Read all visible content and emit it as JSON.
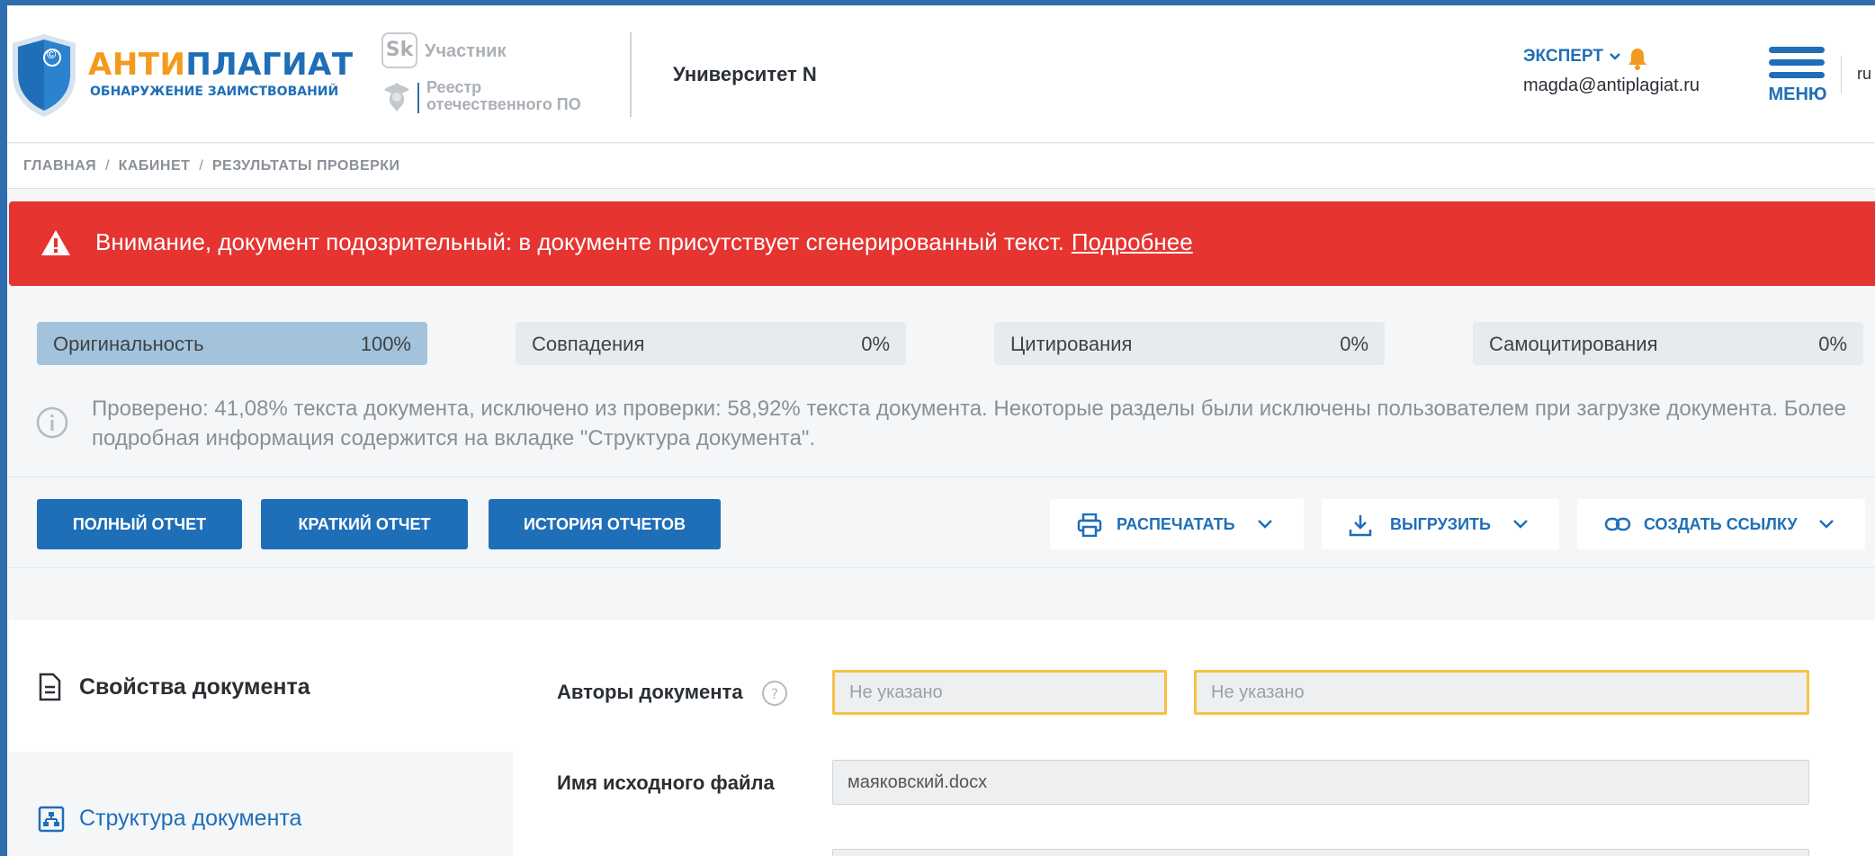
{
  "header": {
    "logo": {
      "title_part1": "АНТИ",
      "title_part2": "ПЛАГИАТ",
      "subtitle": "ОБНАРУЖЕНИЕ ЗАИМСТВОВАНИЙ",
      "shield_symbol": "©"
    },
    "sk": {
      "mark": "Sk",
      "label": "Участник"
    },
    "registry": {
      "line1": "Реестр",
      "line2": "отечественного ПО"
    },
    "organization": "Университет N",
    "user": {
      "role": "ЭКСПЕРТ",
      "email": "magda@antiplagiat.ru"
    },
    "menu_label": "МЕНЮ",
    "language": "ru"
  },
  "breadcrumb": [
    "ГЛАВНАЯ",
    "КАБИНЕТ",
    "РЕЗУЛЬТАТЫ ПРОВЕРКИ"
  ],
  "alert": {
    "text": "Внимание, документ подозрительный: в документе присутствует сгенерированный текст.",
    "link": "Подробнее"
  },
  "metrics": [
    {
      "label": "Оригинальность",
      "value": "100%"
    },
    {
      "label": "Совпадения",
      "value": "0%"
    },
    {
      "label": "Цитирования",
      "value": "0%"
    },
    {
      "label": "Самоцитирования",
      "value": "0%"
    }
  ],
  "info": "Проверено: 41,08% текста документа, исключено из проверки: 58,92% текста документа. Некоторые разделы были исключены пользователем при загрузке документа. Более подробная информация содержится на вкладке \"Структура документа\".",
  "toolbar": {
    "full_report": "ПОЛНЫЙ ОТЧЕТ",
    "short_report": "КРАТКИЙ ОТЧЕТ",
    "history": "ИСТОРИЯ ОТЧЕТОВ",
    "print": "РАСПЕЧАТАТЬ",
    "export": "ВЫГРУЗИТЬ",
    "create_link": "СОЗДАТЬ ССЫЛКУ"
  },
  "side_nav": {
    "properties": "Свойства документа",
    "structure": "Структура документа"
  },
  "form": {
    "authors_label": "Авторы документа",
    "author1_placeholder": "Не указано",
    "author2_placeholder": "Не указано",
    "filename_label": "Имя исходного файла",
    "filename_value": "маяковский.docx"
  },
  "colors": {
    "brand_blue": "#1f6eb8",
    "brand_orange": "#f39a1f",
    "alert_red": "#e63431",
    "originality_fill": "#a2c3db",
    "warning_border": "#f7c244"
  },
  "icons": [
    "shield-logo-icon",
    "sk-icon",
    "eagle-emblem-icon",
    "chevron-down-icon",
    "bell-icon",
    "hamburger-menu-icon",
    "warning-triangle-icon",
    "info-circle-icon",
    "printer-icon",
    "download-icon",
    "link-icon",
    "document-icon",
    "structure-icon",
    "help-icon"
  ]
}
